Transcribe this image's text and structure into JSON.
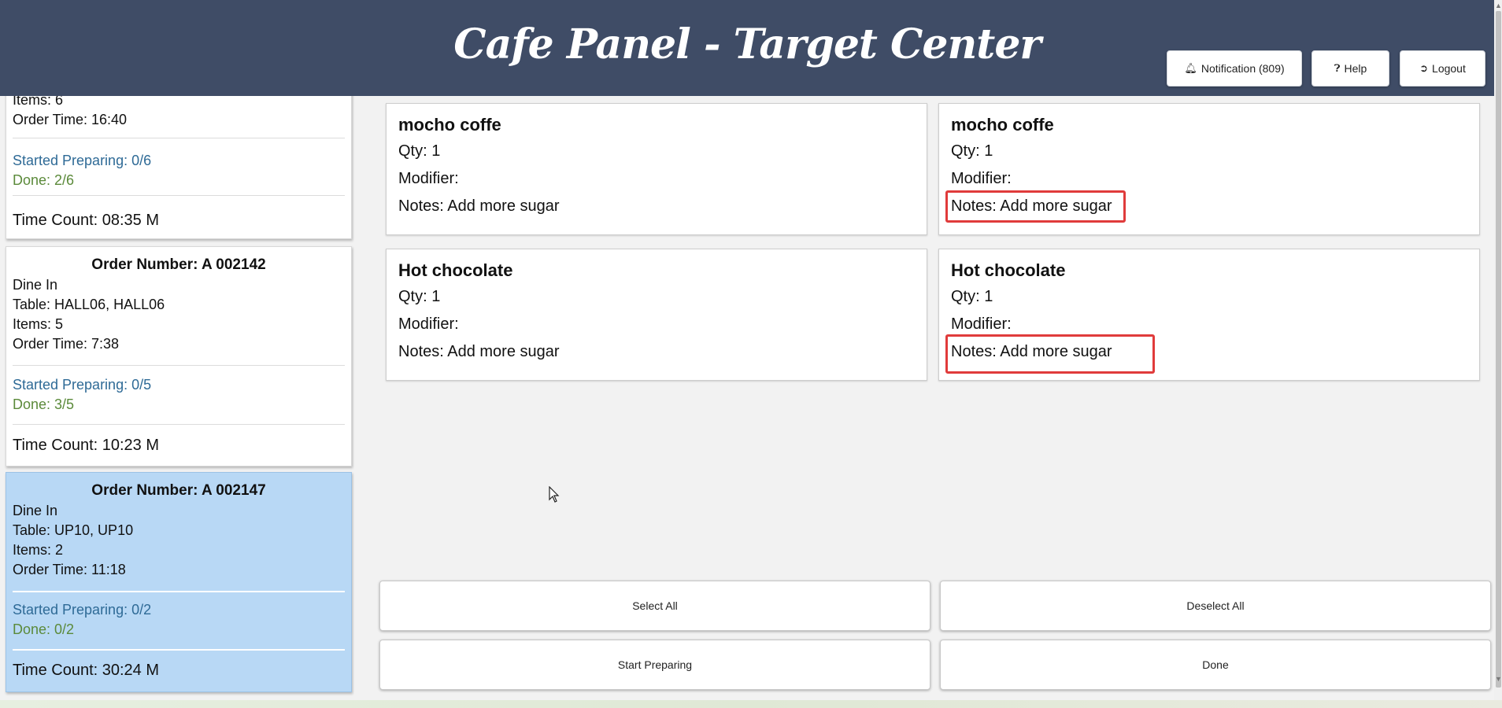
{
  "header": {
    "title": "Cafe Panel - Target Center",
    "notification_label": "Notification (809)",
    "help_label": "Help",
    "logout_label": "Logout"
  },
  "orders": [
    {
      "items": "Items: 6",
      "order_time": "Order Time: 16:40",
      "started": "Started Preparing: 0/6",
      "done": "Done: 2/6",
      "time_count": "Time Count: 08:35 M"
    },
    {
      "number": "Order Number: A 002142",
      "type": "Dine In",
      "table": "Table: HALL06, HALL06",
      "items": "Items: 5",
      "order_time": "Order Time: 7:38",
      "started": "Started Preparing: 0/5",
      "done": "Done: 3/5",
      "time_count": "Time Count: 10:23 M"
    },
    {
      "number": "Order Number: A 002147",
      "type": "Dine In",
      "table": "Table: UP10, UP10",
      "items": "Items: 2",
      "order_time": "Order Time: 11:18",
      "started": "Started Preparing: 0/2",
      "done": "Done: 0/2",
      "time_count": "Time Count: 30:24 M",
      "selected": true
    }
  ],
  "items": [
    {
      "name": "mocho coffe",
      "qty": "Qty: 1",
      "modifier": "Modifier:",
      "notes": "Notes: Add more sugar"
    },
    {
      "name": "mocho coffe",
      "qty": "Qty: 1",
      "modifier": "Modifier:",
      "notes": "Notes: Add more sugar",
      "highlighted": true
    },
    {
      "name": "Hot chocolate",
      "qty": "Qty: 1",
      "modifier": "Modifier:",
      "notes": "Notes: Add more sugar"
    },
    {
      "name": "Hot chocolate",
      "qty": "Qty: 1",
      "modifier": "Modifier:",
      "notes": "Notes: Add more sugar",
      "highlighted": true
    }
  ],
  "actions": {
    "select_all": "Select All",
    "deselect_all": "Deselect All",
    "start_preparing": "Start Preparing",
    "done": "Done"
  },
  "icons": {
    "notification": "bell-icon",
    "help": "question-circle-icon",
    "logout": "sign-out-icon",
    "cursor": "mouse-pointer-icon"
  },
  "colors": {
    "header_bg": "#3f4c66",
    "selected_order_bg": "#b8d8f5",
    "started_text": "#2e6a96",
    "done_text": "#5b8a3a",
    "highlight_border": "#e03b3b"
  }
}
